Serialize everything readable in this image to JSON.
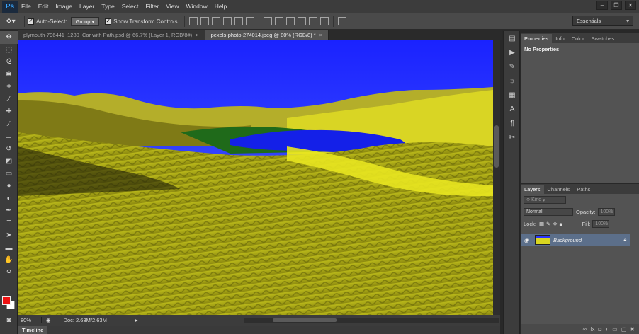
{
  "menubar": {
    "logo": "Ps",
    "items": [
      "File",
      "Edit",
      "Image",
      "Layer",
      "Type",
      "Select",
      "Filter",
      "View",
      "Window",
      "Help"
    ],
    "window_controls": [
      "–",
      "❐",
      "✕"
    ]
  },
  "options": {
    "auto_select_label": "Auto-Select:",
    "auto_select_value": "Group",
    "show_transform_label": "Show Transform Controls",
    "workspace": "Essentials"
  },
  "doc_tabs": [
    {
      "label": "plymouth-796441_1280_Car with Path.psd @ 66.7% (Layer 1, RGB/8#)",
      "close": "×"
    },
    {
      "label": "pexels-photo-274014.jpeg @ 80% (RGB/8) *",
      "close": "×"
    }
  ],
  "status": {
    "zoom": "80%",
    "doc": "Doc: 2.63M/2.63M"
  },
  "timeline": {
    "label": "Timeline"
  },
  "properties": {
    "tabs": [
      "Properties",
      "Info",
      "Color",
      "Swatches"
    ],
    "body": "No Properties"
  },
  "layers": {
    "tabs": [
      "Layers",
      "Channels",
      "Paths"
    ],
    "kind": "Kind",
    "blend_mode": "Normal",
    "opacity_label": "Opacity:",
    "opacity_value": "100%",
    "lock_label": "Lock:",
    "fill_label": "Fill:",
    "fill_value": "100%",
    "layer_name": "Background"
  },
  "colors": {
    "foreground": "#e01010",
    "background": "#ffffff",
    "sky": "#1f2cff",
    "sand": "#c8c41c"
  }
}
